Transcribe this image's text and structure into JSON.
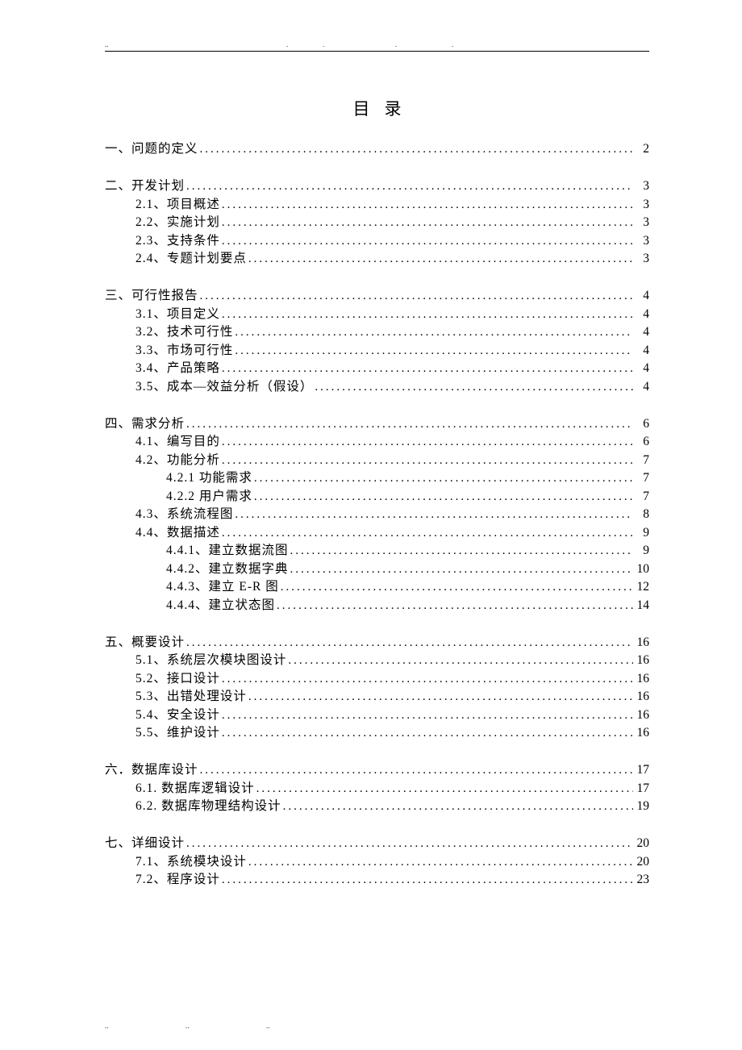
{
  "title": "目录",
  "toc": [
    {
      "entries": [
        {
          "level": 0,
          "label": "一、问题的定义",
          "page": "2"
        }
      ]
    },
    {
      "entries": [
        {
          "level": 0,
          "label": "二、开发计划",
          "page": "3"
        },
        {
          "level": 1,
          "label": "2.1、项目概述 ",
          "page": "3"
        },
        {
          "level": 1,
          "label": "2.2、实施计划 ",
          "page": "3"
        },
        {
          "level": 1,
          "label": "2.3、支持条件 ",
          "page": "3"
        },
        {
          "level": 1,
          "label": "2.4、专题计划要点 ",
          "page": "3"
        }
      ]
    },
    {
      "entries": [
        {
          "level": 0,
          "label": "三、可行性报告",
          "page": "4"
        },
        {
          "level": 1,
          "label": "3.1、项目定义 ",
          "page": "4"
        },
        {
          "level": 1,
          "label": "3.2、技术可行性 ",
          "page": "4"
        },
        {
          "level": 1,
          "label": "3.3、市场可行性 ",
          "page": "4"
        },
        {
          "level": 1,
          "label": "3.4、产品策略 ",
          "page": "4"
        },
        {
          "level": 1,
          "label": "3.5、成本—效益分析（假设） ",
          "page": "4"
        }
      ]
    },
    {
      "entries": [
        {
          "level": 0,
          "label": "四、需求分析",
          "page": "6"
        },
        {
          "level": 1,
          "label": "4.1、编写目的 ",
          "page": "6"
        },
        {
          "level": 1,
          "label": "4.2、功能分析 ",
          "page": "7"
        },
        {
          "level": 2,
          "label": "4.2.1  功能需求",
          "page": "7"
        },
        {
          "level": 2,
          "label": "4.2.2  用户需求",
          "page": "7"
        },
        {
          "level": 1,
          "label": "4.3、系统流程图 ",
          "page": "8"
        },
        {
          "level": 1,
          "label": "4.4、数据描述 ",
          "page": "9"
        },
        {
          "level": 2,
          "label": "4.4.1、建立数据流图",
          "page": "9"
        },
        {
          "level": 2,
          "label": "4.4.2、建立数据字典",
          "page": "10"
        },
        {
          "level": 2,
          "label": "4.4.3、建立 E-R 图",
          "page": "12"
        },
        {
          "level": 2,
          "label": "4.4.4、建立状态图",
          "page": "14"
        }
      ]
    },
    {
      "entries": [
        {
          "level": 0,
          "label": "五、概要设计",
          "page": "16"
        },
        {
          "level": 1,
          "label": "5.1、系统层次模块图设计 ",
          "page": "16"
        },
        {
          "level": 1,
          "label": "5.2、接口设计 ",
          "page": "16"
        },
        {
          "level": 1,
          "label": "5.3、出错处理设计 ",
          "page": "16"
        },
        {
          "level": 1,
          "label": "5.4、安全设计 ",
          "page": "16"
        },
        {
          "level": 1,
          "label": "5.5、维护设计 ",
          "page": "16"
        }
      ]
    },
    {
      "entries": [
        {
          "level": 0,
          "label": "六．数据库设计",
          "page": "17"
        },
        {
          "level": 1,
          "label": "6.1. 数据库逻辑设计 ",
          "page": "17"
        },
        {
          "level": 1,
          "label": "6.2. 数据库物理结构设计 ",
          "page": "19"
        }
      ]
    },
    {
      "entries": [
        {
          "level": 0,
          "label": "七、详细设计",
          "page": "20"
        },
        {
          "level": 1,
          "label": "7.1、系统模块设计 ",
          "page": "20"
        },
        {
          "level": 1,
          "label": "7.2、程序设计 ",
          "page": "23"
        }
      ]
    }
  ]
}
